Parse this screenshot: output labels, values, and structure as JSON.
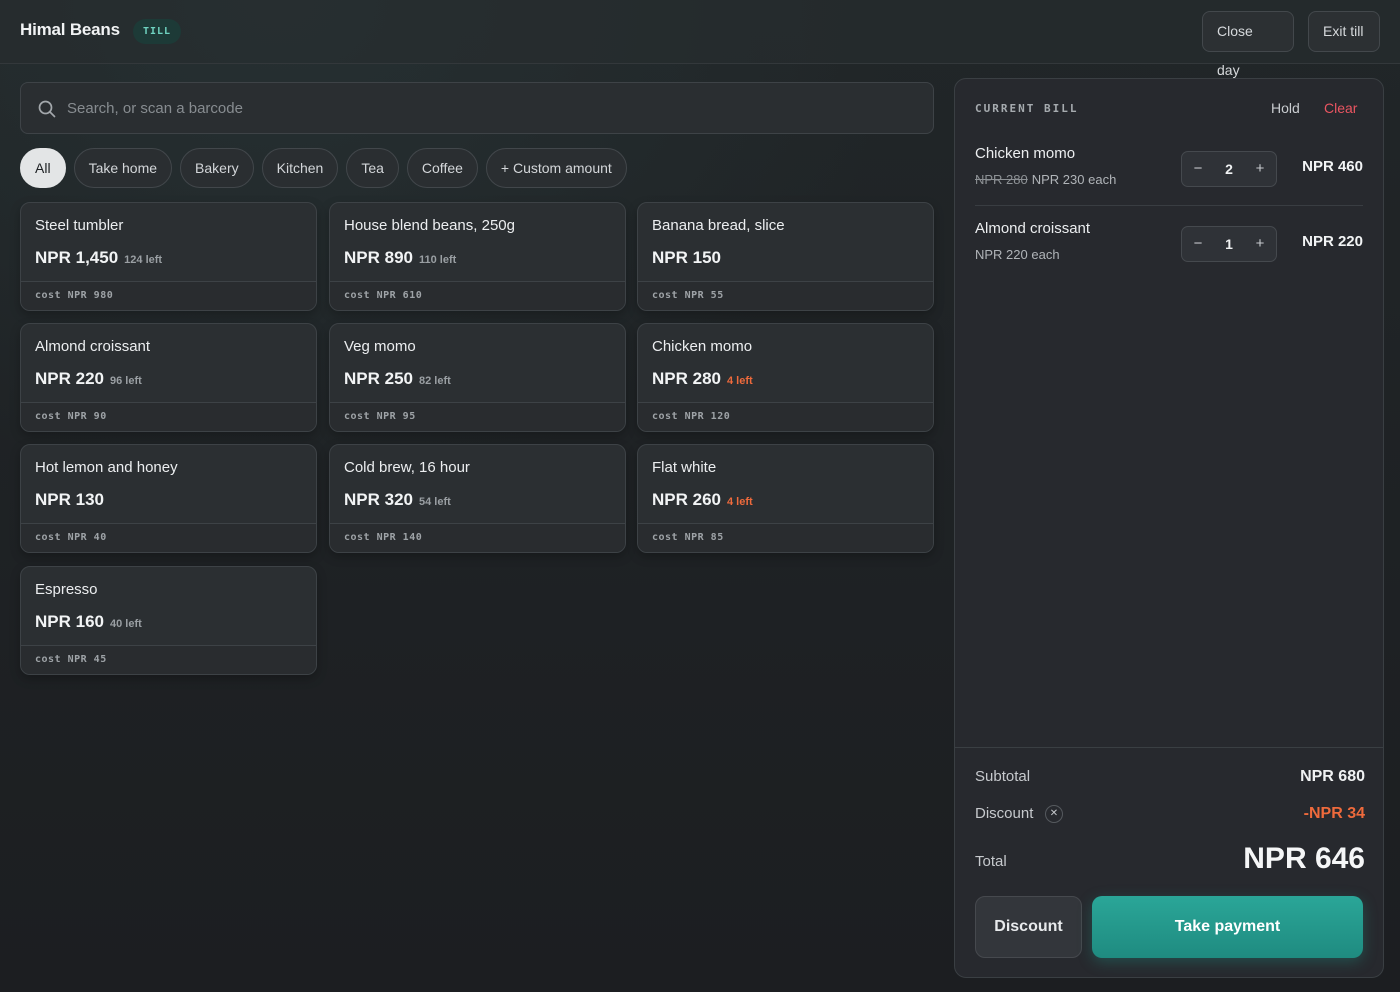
{
  "header": {
    "brand": "Himal Beans",
    "badge": "TILL",
    "close_day": "Close day",
    "exit_till": "Exit till"
  },
  "search": {
    "placeholder": "Search, or scan a barcode",
    "value": ""
  },
  "categories": [
    {
      "label": "All",
      "active": true
    },
    {
      "label": "Take home",
      "active": false
    },
    {
      "label": "Bakery",
      "active": false
    },
    {
      "label": "Kitchen",
      "active": false
    },
    {
      "label": "Tea",
      "active": false
    },
    {
      "label": "Coffee",
      "active": false
    },
    {
      "label": "+ Custom amount",
      "active": false
    }
  ],
  "products": [
    {
      "name": "Steel tumbler",
      "price": "NPR 1,450",
      "stock": "124 left",
      "low": false,
      "cost": "cost NPR 980"
    },
    {
      "name": "House blend beans, 250g",
      "price": "NPR 890",
      "stock": "110 left",
      "low": false,
      "cost": "cost NPR 610"
    },
    {
      "name": "Banana bread, slice",
      "price": "NPR 150",
      "stock": "",
      "low": false,
      "cost": "cost NPR 55"
    },
    {
      "name": "Almond croissant",
      "price": "NPR 220",
      "stock": "96 left",
      "low": false,
      "cost": "cost NPR 90"
    },
    {
      "name": "Veg momo",
      "price": "NPR 250",
      "stock": "82 left",
      "low": false,
      "cost": "cost NPR 95"
    },
    {
      "name": "Chicken momo",
      "price": "NPR 280",
      "stock": "4 left",
      "low": true,
      "cost": "cost NPR 120"
    },
    {
      "name": "Hot lemon and honey",
      "price": "NPR 130",
      "stock": "",
      "low": false,
      "cost": "cost NPR 40"
    },
    {
      "name": "Cold brew, 16 hour",
      "price": "NPR 320",
      "stock": "54 left",
      "low": false,
      "cost": "cost NPR 140"
    },
    {
      "name": "Flat white",
      "price": "NPR 260",
      "stock": "4 left",
      "low": true,
      "cost": "cost NPR 85"
    },
    {
      "name": "Espresso",
      "price": "NPR 160",
      "stock": "40 left",
      "low": false,
      "cost": "cost NPR 45"
    }
  ],
  "bill": {
    "title": "CURRENT BILL",
    "hold": "Hold",
    "clear": "Clear",
    "lines": [
      {
        "name": "Chicken momo",
        "original_price": "NPR 280",
        "unit": "NPR 230 each",
        "qty": "2",
        "total": "NPR 460"
      },
      {
        "name": "Almond croissant",
        "original_price": "",
        "unit": "NPR 220 each",
        "qty": "1",
        "total": "NPR 220"
      }
    ],
    "minus": "−",
    "plus": "+",
    "subtotal_label": "Subtotal",
    "subtotal": "NPR 680",
    "discount_label": "Discount",
    "discount_remove": "✕",
    "discount": "-NPR 34",
    "total_label": "Total",
    "total": "NPR 646",
    "discount_button": "Discount",
    "pay_button": "Take payment"
  },
  "colors": {
    "accent": "#23998b",
    "danger": "#ea5561",
    "warning": "#ee6a3c",
    "badge_text": "#6fd3c1"
  }
}
